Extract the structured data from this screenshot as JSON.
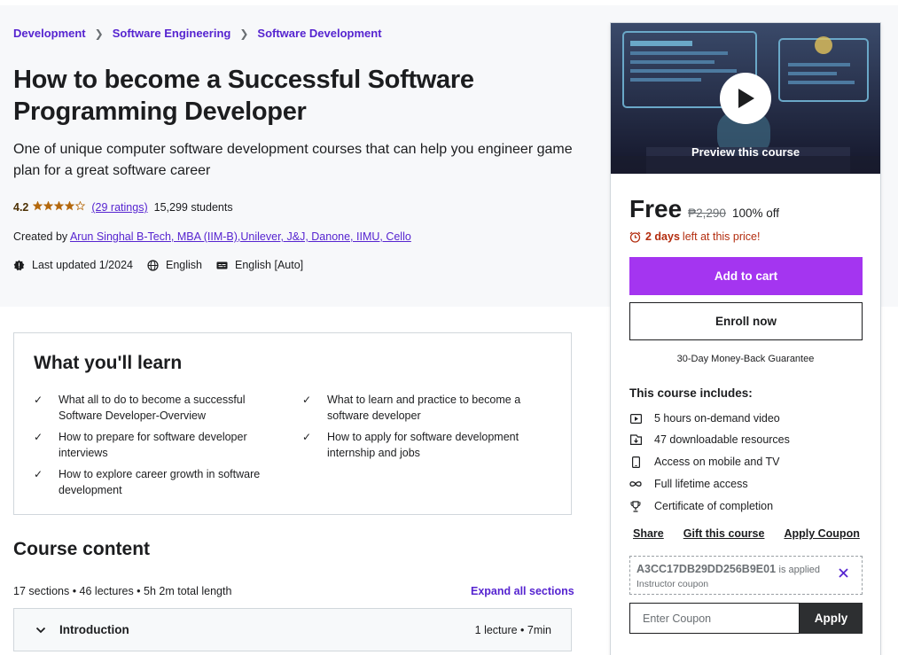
{
  "breadcrumb": [
    "Development",
    "Software Engineering",
    "Software Development"
  ],
  "course": {
    "title": "How to become a Successful Software Programming Developer",
    "subtitle": "One of unique computer software development courses that can help you engineer game plan for a great software career",
    "rating": "4.2",
    "rating_value": 4.2,
    "ratings_count": "(29 ratings)",
    "students": "15,299 students",
    "created_by_label": "Created by",
    "instructor": "Arun Singhal B-Tech, MBA (IIM-B),Unilever, J&J, Danone, IIMU, Cello",
    "last_updated": "Last updated 1/2024",
    "language": "English",
    "captions": "English [Auto]"
  },
  "learn": {
    "title": "What you'll learn",
    "items": [
      "What all to do to become a successful Software Developer-Overview",
      "What to learn and practice to become a software developer",
      "How to prepare for software developer interviews",
      "How to apply for software development internship and jobs",
      "How to explore career growth in software development"
    ]
  },
  "content": {
    "title": "Course content",
    "stats": "17 sections • 46 lectures • 5h 2m total length",
    "expand_label": "Expand all sections",
    "sections": [
      {
        "name": "Introduction",
        "meta": "1 lecture • 7min"
      }
    ]
  },
  "sidebar": {
    "preview_label": "Preview this course",
    "price": "Free",
    "original_price": "₱2,290",
    "discount": "100% off",
    "timer_days": "2 days",
    "timer_text": "left at this price!",
    "add_to_cart": "Add to cart",
    "enroll": "Enroll now",
    "guarantee": "30-Day Money-Back Guarantee",
    "includes_title": "This course includes:",
    "includes": [
      {
        "icon": "video-icon",
        "text": "5 hours on-demand video"
      },
      {
        "icon": "download-icon",
        "text": "47 downloadable resources"
      },
      {
        "icon": "mobile-icon",
        "text": "Access on mobile and TV"
      },
      {
        "icon": "infinity-icon",
        "text": "Full lifetime access"
      },
      {
        "icon": "trophy-icon",
        "text": "Certificate of completion"
      }
    ],
    "links": [
      "Share",
      "Gift this course",
      "Apply Coupon"
    ],
    "coupon_code": "A3CC17DB29DD256B9E01",
    "coupon_applied": "is applied",
    "coupon_type": "Instructor coupon",
    "coupon_placeholder": "Enter Coupon",
    "apply_label": "Apply"
  },
  "colors": {
    "brand_purple": "#a435f0",
    "link_purple": "#5624d0",
    "star_orange": "#b4690e",
    "timer_red": "#b32d0f",
    "dark": "#1c1d1f"
  }
}
